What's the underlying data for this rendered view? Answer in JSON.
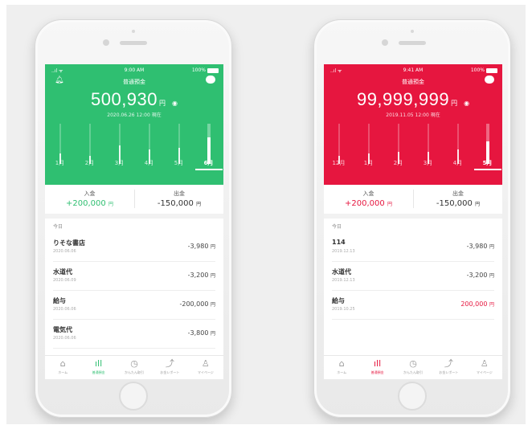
{
  "phones": [
    {
      "status": {
        "signal": "..ıl ᯤ",
        "time": "9:00 AM",
        "battery": "100%"
      },
      "account_title": "普通預金",
      "balance": "500,930",
      "yen": "円",
      "as_of": "2020.06.26 12:00 現在",
      "chart": {
        "months": [
          "1月",
          "2月",
          "3月",
          "4月",
          "5月",
          "6月"
        ],
        "levels": [
          0.25,
          0.2,
          0.45,
          0.35,
          0.4,
          0.65
        ],
        "active_index": 5
      },
      "deposit": {
        "label": "入金",
        "amount": "+200,000",
        "yen": "円"
      },
      "withdrawal": {
        "label": "出金",
        "amount": "-150,000",
        "yen": "円"
      },
      "today_label": "今日",
      "transactions": [
        {
          "name": "りそな書店",
          "date": "2020.06.06",
          "amount": "-3,980",
          "yen": "円",
          "positive": false
        },
        {
          "name": "水道代",
          "date": "2020.06.09",
          "amount": "-3,200",
          "yen": "円",
          "positive": false
        },
        {
          "name": "給与",
          "date": "2020.06.06",
          "amount": "-200,000",
          "yen": "円",
          "positive": false
        },
        {
          "name": "電気代",
          "date": "2020.06.06",
          "amount": "-3,800",
          "yen": "円",
          "positive": false
        }
      ],
      "tabs": [
        {
          "label": "ホーム",
          "icon": "⌂",
          "icon_name": "home-icon"
        },
        {
          "label": "普通預金",
          "icon": "ıll",
          "icon_name": "bar-chart-icon"
        },
        {
          "label": "かんたん取引",
          "icon": "◷",
          "icon_name": "transfer-icon"
        },
        {
          "label": "お金レポート",
          "icon": "⤴",
          "icon_name": "report-icon"
        },
        {
          "label": "マイページ",
          "icon": "♙",
          "icon_name": "user-icon"
        }
      ],
      "active_tab": 1,
      "accent_color": "#2fbf71"
    },
    {
      "status": {
        "signal": "..ıl ᯤ",
        "time": "9:41 AM",
        "battery": "100%"
      },
      "account_title": "普通預金",
      "balance": "99,999,999",
      "yen": "円",
      "as_of": "2019.11.05 12:00 現在",
      "chart": {
        "months": [
          "12月",
          "1月",
          "2月",
          "3月",
          "4月",
          "5月"
        ],
        "levels": [
          0.2,
          0.25,
          0.3,
          0.3,
          0.35,
          0.55
        ],
        "active_index": 5
      },
      "deposit": {
        "label": "入金",
        "amount": "+200,000",
        "yen": "円"
      },
      "withdrawal": {
        "label": "出金",
        "amount": "-150,000",
        "yen": "円"
      },
      "today_label": "今日",
      "transactions": [
        {
          "name": "114",
          "date": "2019.12.13",
          "amount": "-3,980",
          "yen": "円",
          "positive": false
        },
        {
          "name": "水道代",
          "date": "2019.12.13",
          "amount": "-3,200",
          "yen": "円",
          "positive": false
        },
        {
          "name": "給与",
          "date": "2019.10.25",
          "amount": "200,000",
          "yen": "円",
          "positive": true
        }
      ],
      "tabs": [
        {
          "label": "ホーム",
          "icon": "⌂",
          "icon_name": "home-icon"
        },
        {
          "label": "普通預金",
          "icon": "ıll",
          "icon_name": "bar-chart-icon"
        },
        {
          "label": "かんたん取引",
          "icon": "◷",
          "icon_name": "transfer-icon"
        },
        {
          "label": "お金レポート",
          "icon": "⤴",
          "icon_name": "report-icon"
        },
        {
          "label": "マイページ",
          "icon": "♙",
          "icon_name": "user-icon"
        }
      ],
      "active_tab": 1,
      "accent_color": "#e6163f"
    }
  ]
}
